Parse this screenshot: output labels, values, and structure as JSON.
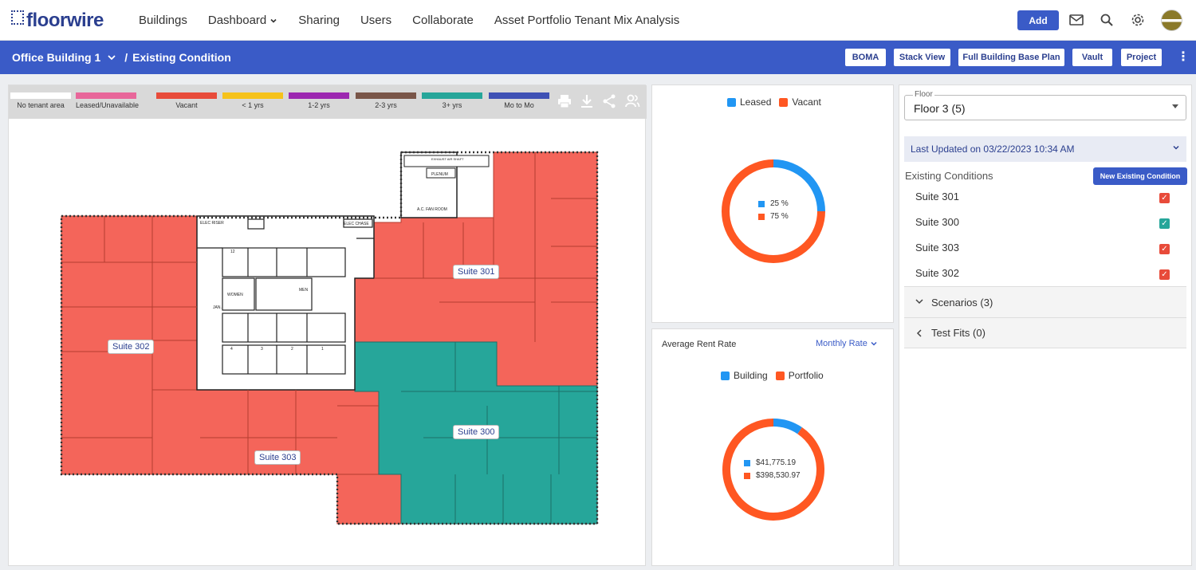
{
  "app": {
    "logo_text": "floorwire",
    "nav": [
      {
        "label": "Buildings"
      },
      {
        "label": "Dashboard",
        "has_dropdown": true
      },
      {
        "label": "Sharing"
      },
      {
        "label": "Users"
      },
      {
        "label": "Collaborate"
      },
      {
        "label": "Asset Portfolio Tenant Mix Analysis"
      }
    ],
    "add_label": "Add",
    "icons": [
      "mail-icon",
      "search-icon",
      "gear-icon"
    ]
  },
  "subbar": {
    "building": "Office Building 1",
    "separator": "/",
    "page": "Existing Condition",
    "buttons": [
      "BOMA",
      "Stack View",
      "Full Building Base Plan",
      "Vault",
      "Project"
    ]
  },
  "legend": [
    {
      "label": "No tenant area",
      "color": "#ffffff"
    },
    {
      "label": "Leased/Unavailable",
      "color": "#e8669a"
    },
    {
      "label": "Vacant",
      "color": "#e84b3a"
    },
    {
      "label": "< 1 yrs",
      "color": "#f5c21b"
    },
    {
      "label": "1-2 yrs",
      "color": "#9c27b0"
    },
    {
      "label": "2-3 yrs",
      "color": "#795548"
    },
    {
      "label": "3+ yrs",
      "color": "#26a69a"
    },
    {
      "label": "Mo to Mo",
      "color": "#3f51b5"
    }
  ],
  "plan": {
    "suites": [
      {
        "label": "Suite 301"
      },
      {
        "label": "Suite 302"
      },
      {
        "label": "Suite 303"
      },
      {
        "label": "Suite 300"
      }
    ],
    "room_labels": [
      "ELEC RISER",
      "ELEC CHASE",
      "WOMEN",
      "MEN",
      "JAN.",
      "PLENUM",
      "A.C. FAN ROOM",
      "EXHAUST AIR SHAFT"
    ],
    "elevator_numbers": [
      "12",
      "4",
      "3",
      "2",
      "1"
    ]
  },
  "leased_chart": {
    "legend": [
      "Leased",
      "Vacant"
    ],
    "center": [
      "25 %",
      "75 %"
    ]
  },
  "rent_chart": {
    "title": "Average Rent Rate",
    "rate_select": "Monthly Rate",
    "legend": [
      "Building",
      "Portfolio"
    ],
    "center": [
      "$41,775.19",
      "$398,530.97"
    ]
  },
  "chart_data": [
    {
      "type": "pie",
      "categories": [
        "Leased",
        "Vacant"
      ],
      "values": [
        25,
        75
      ],
      "colors": [
        "#2196f3",
        "#ff5722"
      ]
    },
    {
      "type": "pie",
      "title": "Average Rent Rate",
      "categories": [
        "Building",
        "Portfolio"
      ],
      "values": [
        41775.19,
        398530.97
      ],
      "colors": [
        "#2196f3",
        "#ff5722"
      ]
    }
  ],
  "right": {
    "floor_label": "Floor",
    "floor_value": "Floor 3 (5)",
    "last_updated": "Last Updated on 03/22/2023 10:34 AM",
    "existing_title": "Existing Conditions",
    "new_button": "New Existing Condition",
    "suites": [
      {
        "label": "Suite 301",
        "color": "#e84b3a"
      },
      {
        "label": "Suite 300",
        "color": "#26a69a"
      },
      {
        "label": "Suite 303",
        "color": "#e84b3a"
      },
      {
        "label": "Suite 302",
        "color": "#e84b3a"
      }
    ],
    "scenarios": "Scenarios (3)",
    "test_fits": "Test Fits (0)"
  }
}
